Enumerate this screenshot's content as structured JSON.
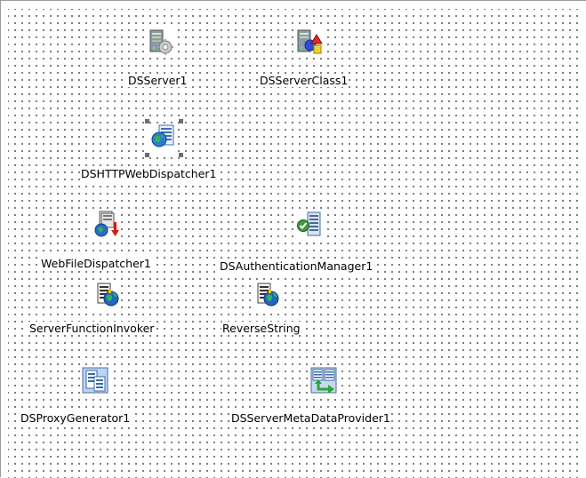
{
  "form": {
    "components": [
      {
        "id": "dsserver1",
        "label": "DSServer1",
        "icon": "server-gear-icon"
      },
      {
        "id": "dsserverclass1",
        "label": "DSServerClass1",
        "icon": "server-shapes-icon"
      },
      {
        "id": "dshttpwebdispatcher1",
        "label": "DSHTTPWebDispatcher1",
        "icon": "globe-document-icon"
      },
      {
        "id": "webfiledispatcher1",
        "label": "WebFileDispatcher1",
        "icon": "file-dispatch-icon"
      },
      {
        "id": "dsauthenticationmanager1",
        "label": "DSAuthenticationManager1",
        "icon": "auth-check-icon"
      },
      {
        "id": "serverfunctioninvoker",
        "label": "ServerFunctionInvoker",
        "icon": "function-globe-icon"
      },
      {
        "id": "reversestring",
        "label": "ReverseString",
        "icon": "function-globe-icon"
      },
      {
        "id": "dsproxygenerator1",
        "label": "DSProxyGenerator1",
        "icon": "proxy-document-icon"
      },
      {
        "id": "dsservermetadataprovider1",
        "label": "DSServerMetaDataProvider1",
        "icon": "metadata-provider-icon"
      }
    ],
    "selected_component": "DSHTTPWebDispatcher1"
  }
}
